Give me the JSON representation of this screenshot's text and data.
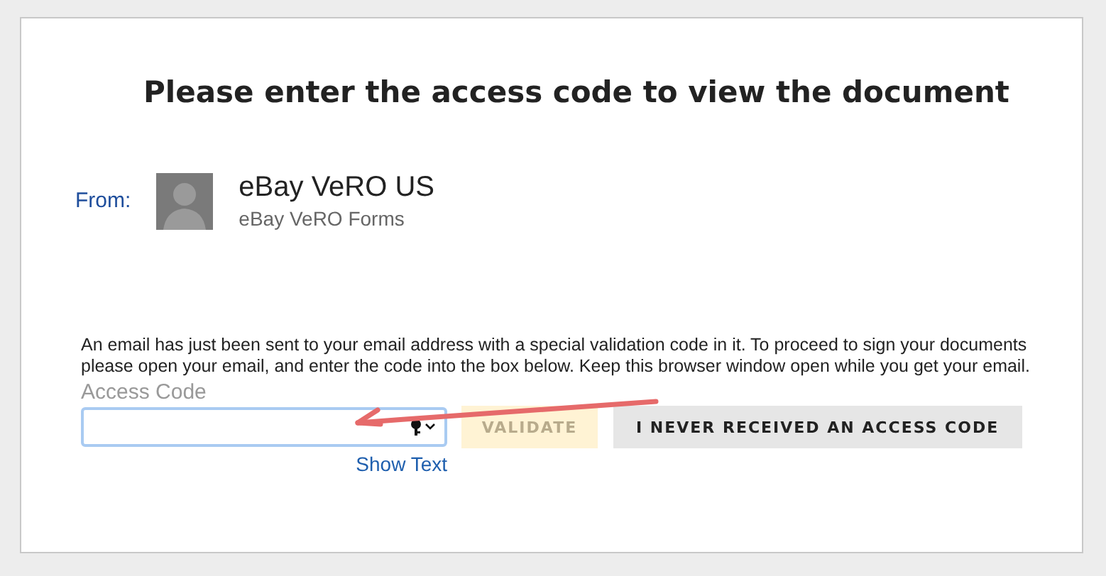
{
  "title": "Please enter the access code to view the document",
  "from": {
    "label": "From:",
    "name": "eBay VeRO US",
    "subtitle": "eBay VeRO Forms"
  },
  "message": "An email has just been sent to your email address with a special validation code in it. To proceed to sign your documents please open your email, and enter the code into the box below. Keep this browser window open while you get your email.",
  "access_code": {
    "label": "Access Code",
    "focused": true
  },
  "show_text": "Show Text",
  "buttons": [
    {
      "label": "VALIDATE",
      "kind": "primary",
      "disabled": true
    },
    {
      "label": "I NEVER RECEIVED AN ACCESS CODE",
      "kind": "secondary",
      "disabled": false
    }
  ]
}
